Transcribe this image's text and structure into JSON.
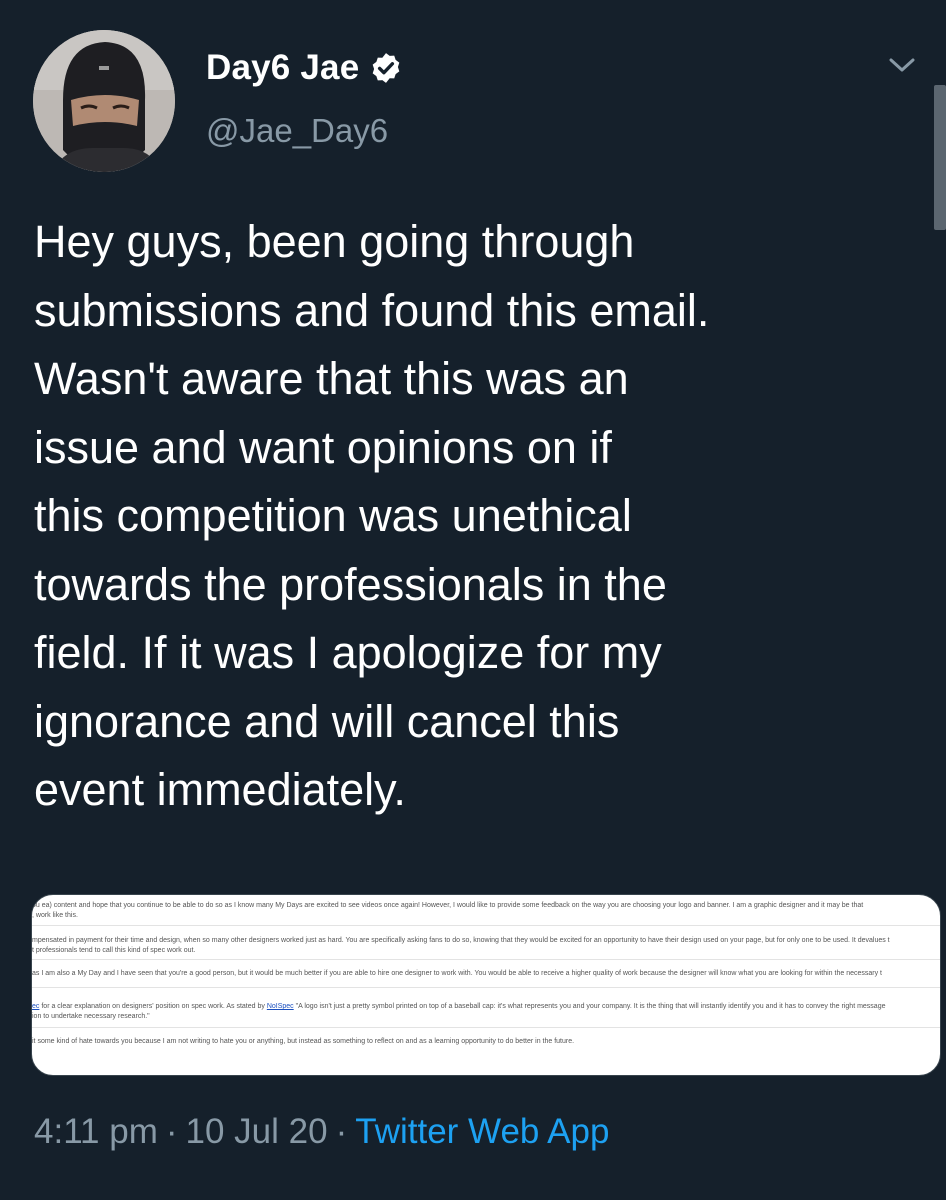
{
  "author": {
    "display_name": "Day6 Jae",
    "handle": "@Jae_Day6",
    "verified_icon": "verified-badge-icon",
    "avatar_icon": "profile-avatar"
  },
  "tweet": {
    "text": "Hey guys, been going through\nsubmissions and found this email.\nWasn't aware that this was an\nissue and want opinions on if\nthis competition was unethical\ntowards the professionals in the\nfield. If it was I apologize for my\nignorance and will cancel this\nevent immediately."
  },
  "media": {
    "lines": [
      "ou ea) content and hope that you continue to be able to do so as I know many My Days are excited to see videos once again! However, I would like to provide some feedback on the way you are choosing your logo and banner. I am a graphic designer and it may be that",
      ", work like this.",
      "mpensated in payment for their time and design, when so many other designers worked just as hard. You are specifically asking fans to do so, knowing that they would be excited for an opportunity to have their design used on your page, but for only one to be used. It devalues t",
      "t professionals tend to call this kind of spec work out.",
      "as I am also a My Day and I have seen that you're a good person, but it would be much better if you are able to hire one designer to work with. You would be able to receive a higher quality of work because the designer will know what you are looking for within the necessary t",
      "for a clear explanation on designers' position on spec work. As stated by ",
      "\"A logo isn't just a pretty symbol printed on top of a baseball cap: it's what represents you and your company. It is the thing that will instantly identify you and it has to convey the right message",
      "ion to undertake necessary research.\"",
      "it some kind of hate towards you because I am not writing to hate you or anything, but instead as something to reflect on and as a learning opportunity to do better in the future."
    ],
    "link_prefix": "ec",
    "link_text": "NoISpec"
  },
  "meta": {
    "time": "4:11 pm",
    "separator": "·",
    "date": "10 Jul 20",
    "source": "Twitter Web App"
  },
  "colors": {
    "background": "#15202b",
    "text": "#ffffff",
    "secondary": "#8899a6",
    "accent": "#1da1f2"
  },
  "icons": {
    "more": "chevron-down-icon"
  }
}
